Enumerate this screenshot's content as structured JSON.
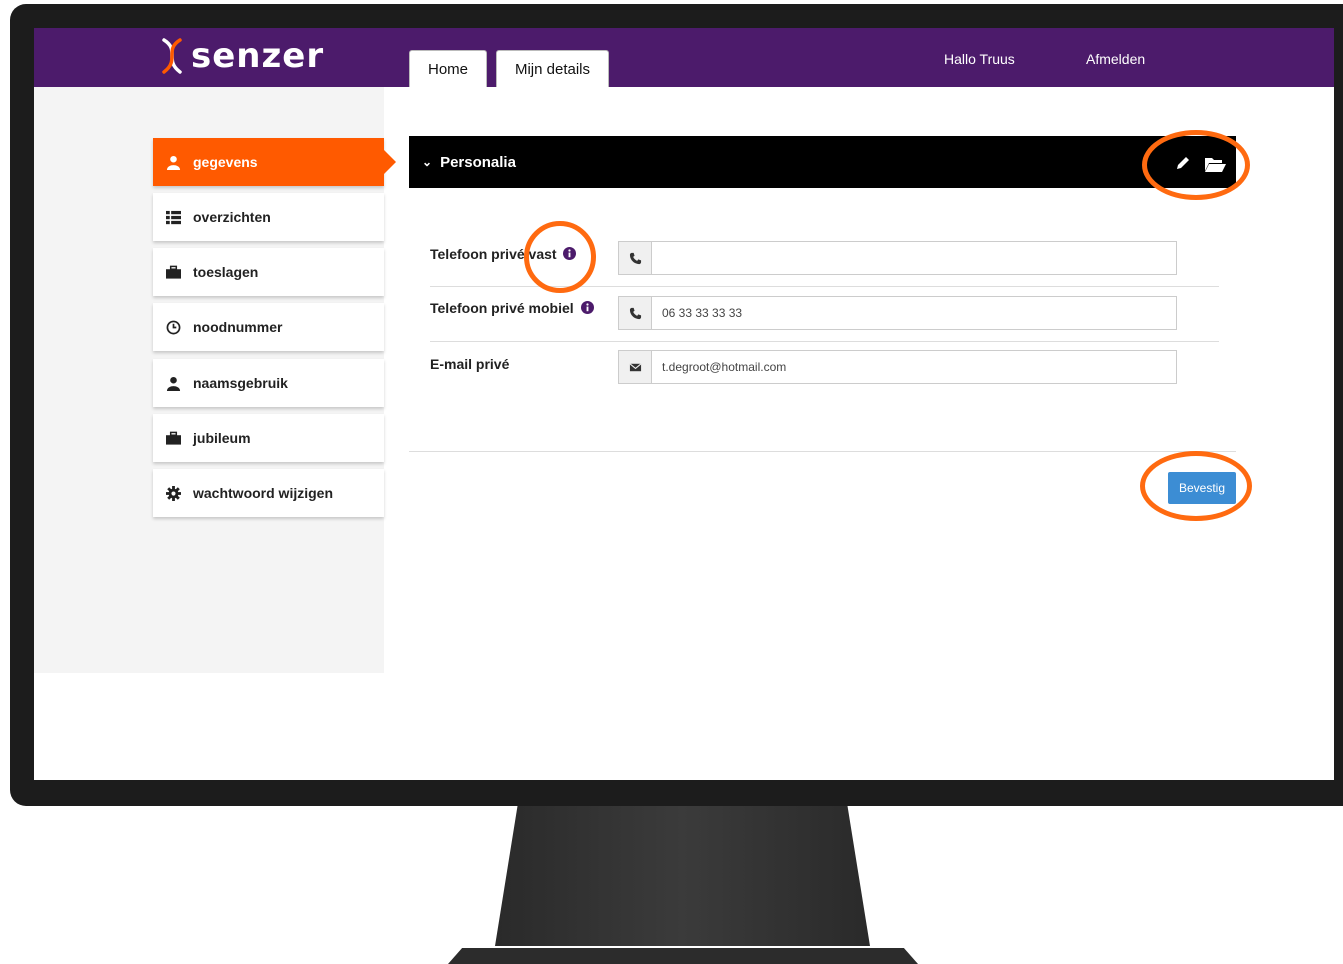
{
  "header": {
    "brand": "senzer",
    "tabs": [
      {
        "label": "Home",
        "active": false
      },
      {
        "label": "Mijn details",
        "active": true
      }
    ],
    "greeting": "Hallo Truus",
    "logout": "Afmelden"
  },
  "sidebar": {
    "items": [
      {
        "label": "gegevens",
        "icon": "user-icon",
        "active": true
      },
      {
        "label": "overzichten",
        "icon": "list-icon",
        "active": false
      },
      {
        "label": "toeslagen",
        "icon": "briefcase-icon",
        "active": false
      },
      {
        "label": "noodnummer",
        "icon": "clock-icon",
        "active": false
      },
      {
        "label": "naamsgebruik",
        "icon": "user-icon",
        "active": false
      },
      {
        "label": "jubileum",
        "icon": "briefcase-icon",
        "active": false
      },
      {
        "label": "wachtwoord wijzigen",
        "icon": "gear-icon",
        "active": false
      }
    ]
  },
  "panel": {
    "title": "Personalia",
    "fields": [
      {
        "label": "Telefoon privé vast",
        "value": "",
        "icon": "phone-icon",
        "has_info": true
      },
      {
        "label": "Telefoon privé mobiel",
        "value": "06 33 33 33 33",
        "icon": "phone-icon",
        "has_info": true
      },
      {
        "label": "E-mail privé",
        "value": "t.degroot@hotmail.com",
        "icon": "envelope-icon",
        "has_info": false
      }
    ],
    "confirm_label": "Bevestig"
  },
  "colors": {
    "brand_purple": "#4c1b6b",
    "accent_orange": "#ff5a00",
    "highlight_orange": "#ff6a10",
    "button_blue": "#3c8dd4"
  }
}
